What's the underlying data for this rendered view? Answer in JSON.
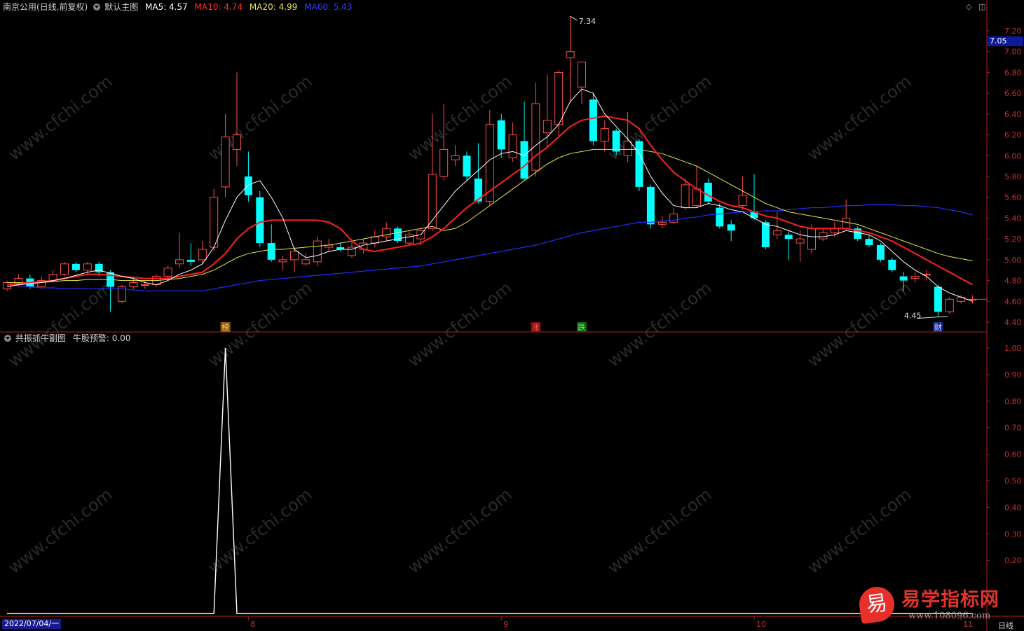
{
  "main_header": {
    "title": "南京公用(日线,前复权)",
    "template": "默认主图",
    "ma5": "MA5: 4.57",
    "ma10": "MA10: 4.74",
    "ma20": "MA20: 4.99",
    "ma60": "MA60: 5.43"
  },
  "sub_header": {
    "title": "共振抓牛副图",
    "indicator": "牛股预警: 0.00"
  },
  "window_controls": [
    "◇",
    "◫"
  ],
  "current_price_label": "7.05",
  "high_label": "7.34",
  "low_label": "4.45",
  "markers": [
    "榜",
    "涨",
    "跌",
    "财"
  ],
  "x_axis": {
    "start_date": "2022/07/04/一",
    "months": [
      "8",
      "9",
      "10",
      "11"
    ],
    "cycle": "日线"
  },
  "brand": {
    "icon": "易",
    "name": "易学指标网",
    "url": "www.108096.com"
  },
  "watermark": "www.cfchi.com",
  "colors": {
    "up": "#ff4d4d",
    "down": "#00ffff",
    "ma5": "#ffffff",
    "ma10": "#ff2020",
    "ma20": "#e6e64a",
    "ma60": "#2030ff",
    "axis": "#b02020"
  },
  "chart_data": [
    {
      "type": "candlestick",
      "title": "南京公用(日线,前复权)",
      "ylim": [
        4.4,
        7.25
      ],
      "yticks": [
        "7.20",
        "7.00",
        "6.80",
        "6.60",
        "6.40",
        "6.20",
        "6.00",
        "5.80",
        "5.60",
        "5.40",
        "5.20",
        "5.00",
        "4.80",
        "4.60",
        "4.40"
      ],
      "candles": [
        [
          4.72,
          4.78,
          4.8,
          4.7
        ],
        [
          4.76,
          4.82,
          4.86,
          4.74
        ],
        [
          4.82,
          4.74,
          4.86,
          4.72
        ],
        [
          4.74,
          4.8,
          4.84,
          4.72
        ],
        [
          4.8,
          4.86,
          4.9,
          4.78
        ],
        [
          4.86,
          4.96,
          4.98,
          4.84
        ],
        [
          4.96,
          4.9,
          4.98,
          4.88
        ],
        [
          4.9,
          4.96,
          4.98,
          4.86
        ],
        [
          4.96,
          4.88,
          4.98,
          4.84
        ],
        [
          4.88,
          4.74,
          4.9,
          4.5
        ],
        [
          4.6,
          4.74,
          4.76,
          4.58
        ],
        [
          4.74,
          4.78,
          4.82,
          4.72
        ],
        [
          4.76,
          4.76,
          4.8,
          4.72
        ],
        [
          4.76,
          4.84,
          4.86,
          4.74
        ],
        [
          4.84,
          4.92,
          4.94,
          4.8
        ],
        [
          4.96,
          5.0,
          5.26,
          4.92
        ],
        [
          5.0,
          4.98,
          5.16,
          4.94
        ],
        [
          5.0,
          5.1,
          5.18,
          4.96
        ],
        [
          5.12,
          5.6,
          5.68,
          5.08
        ],
        [
          5.7,
          6.18,
          6.4,
          5.6
        ],
        [
          6.06,
          6.2,
          6.8,
          5.9
        ],
        [
          5.8,
          5.62,
          6.04,
          5.56
        ],
        [
          5.6,
          5.16,
          5.66,
          5.12
        ],
        [
          5.16,
          5.0,
          5.34,
          4.98
        ],
        [
          4.98,
          5.0,
          5.04,
          4.9
        ],
        [
          5.0,
          5.08,
          5.12,
          4.88
        ],
        [
          4.96,
          5.0,
          5.06,
          4.94
        ],
        [
          4.98,
          5.18,
          5.22,
          4.94
        ],
        [
          5.12,
          5.14,
          5.2,
          5.08
        ],
        [
          5.12,
          5.1,
          5.16,
          5.08
        ],
        [
          5.04,
          5.12,
          5.2,
          5.02
        ],
        [
          5.1,
          5.16,
          5.2,
          5.06
        ],
        [
          5.16,
          5.22,
          5.28,
          5.12
        ],
        [
          5.22,
          5.3,
          5.36,
          5.18
        ],
        [
          5.3,
          5.18,
          5.32,
          5.16
        ],
        [
          5.16,
          5.24,
          5.28,
          5.14
        ],
        [
          5.2,
          5.28,
          5.3,
          5.14
        ],
        [
          5.3,
          5.82,
          6.4,
          5.28
        ],
        [
          5.8,
          6.06,
          6.5,
          5.76
        ],
        [
          5.96,
          6.0,
          6.1,
          5.9
        ],
        [
          6.0,
          5.8,
          6.04,
          5.76
        ],
        [
          5.78,
          5.56,
          6.12,
          5.54
        ],
        [
          5.56,
          6.3,
          6.44,
          5.52
        ],
        [
          6.34,
          6.06,
          6.4,
          5.98
        ],
        [
          5.98,
          6.2,
          6.32,
          5.94
        ],
        [
          6.14,
          5.78,
          6.52,
          5.76
        ],
        [
          5.86,
          6.5,
          6.7,
          5.8
        ],
        [
          6.22,
          6.34,
          6.78,
          6.08
        ],
        [
          6.3,
          6.8,
          6.82,
          6.18
        ],
        [
          6.94,
          7.0,
          7.34,
          6.52
        ],
        [
          6.66,
          6.9,
          6.9,
          6.5
        ],
        [
          6.54,
          6.14,
          6.6,
          6.1
        ],
        [
          6.14,
          6.26,
          6.34,
          6.04
        ],
        [
          6.24,
          6.04,
          6.26,
          6.0
        ],
        [
          6.0,
          6.14,
          6.42,
          5.94
        ],
        [
          6.14,
          5.7,
          6.16,
          5.66
        ],
        [
          5.7,
          5.34,
          5.72,
          5.3
        ],
        [
          5.34,
          5.36,
          5.42,
          5.3
        ],
        [
          5.36,
          5.44,
          5.5,
          5.34
        ],
        [
          5.5,
          5.72,
          5.78,
          5.48
        ],
        [
          5.52,
          5.68,
          5.9,
          5.5
        ],
        [
          5.74,
          5.56,
          5.78,
          5.54
        ],
        [
          5.5,
          5.32,
          5.54,
          5.3
        ],
        [
          5.34,
          5.28,
          5.38,
          5.18
        ],
        [
          5.52,
          5.62,
          5.8,
          5.48
        ],
        [
          5.46,
          5.4,
          5.82,
          5.38
        ],
        [
          5.36,
          5.12,
          5.38,
          5.1
        ],
        [
          5.24,
          5.28,
          5.46,
          5.2
        ],
        [
          5.24,
          5.2,
          5.28,
          5.0
        ],
        [
          5.16,
          5.2,
          5.28,
          4.98
        ],
        [
          5.1,
          5.3,
          5.34,
          5.06
        ],
        [
          5.2,
          5.26,
          5.3,
          5.18
        ],
        [
          5.26,
          5.3,
          5.36,
          5.22
        ],
        [
          5.3,
          5.4,
          5.58,
          5.28
        ],
        [
          5.3,
          5.2,
          5.32,
          5.18
        ],
        [
          5.2,
          5.14,
          5.24,
          5.12
        ],
        [
          5.14,
          5.0,
          5.16,
          4.98
        ],
        [
          5.0,
          4.9,
          5.02,
          4.88
        ],
        [
          4.84,
          4.8,
          4.88,
          4.7
        ],
        [
          4.82,
          4.84,
          4.88,
          4.78
        ],
        [
          4.86,
          4.86,
          4.9,
          4.8
        ],
        [
          4.74,
          4.5,
          4.76,
          4.45
        ],
        [
          4.5,
          4.62,
          4.64,
          4.48
        ],
        [
          4.6,
          4.64,
          4.66,
          4.58
        ],
        [
          4.62,
          4.62,
          4.66,
          4.58
        ]
      ],
      "ma5": [
        4.74,
        4.76,
        4.77,
        4.78,
        4.8,
        4.82,
        4.85,
        4.88,
        4.9,
        4.87,
        4.84,
        4.82,
        4.78,
        4.76,
        4.8,
        4.86,
        4.9,
        4.96,
        5.12,
        5.38,
        5.6,
        5.72,
        5.76,
        5.6,
        5.4,
        5.1,
        5.02,
        5.04,
        5.08,
        5.1,
        5.1,
        5.14,
        5.16,
        5.18,
        5.2,
        5.22,
        5.24,
        5.38,
        5.52,
        5.66,
        5.76,
        5.86,
        5.96,
        6.02,
        6.04,
        6.0,
        6.1,
        6.18,
        6.3,
        6.52,
        6.64,
        6.6,
        6.4,
        6.28,
        6.16,
        6.02,
        5.8,
        5.64,
        5.52,
        5.5,
        5.5,
        5.54,
        5.52,
        5.48,
        5.46,
        5.4,
        5.34,
        5.32,
        5.28,
        5.24,
        5.22,
        5.22,
        5.24,
        5.28,
        5.26,
        5.24,
        5.18,
        5.08,
        4.98,
        4.9,
        4.84,
        4.74,
        4.68,
        4.64,
        4.6
      ],
      "ma10": [
        4.76,
        4.77,
        4.78,
        4.79,
        4.8,
        4.82,
        4.84,
        4.86,
        4.86,
        4.85,
        4.84,
        4.83,
        4.82,
        4.82,
        4.82,
        4.84,
        4.86,
        4.88,
        4.96,
        5.06,
        5.2,
        5.3,
        5.36,
        5.38,
        5.38,
        5.38,
        5.38,
        5.38,
        5.36,
        5.3,
        5.18,
        5.1,
        5.08,
        5.1,
        5.12,
        5.14,
        5.16,
        5.22,
        5.3,
        5.4,
        5.5,
        5.58,
        5.66,
        5.74,
        5.82,
        5.9,
        6.0,
        6.08,
        6.18,
        6.28,
        6.34,
        6.36,
        6.38,
        6.36,
        6.34,
        6.26,
        6.1,
        5.96,
        5.84,
        5.76,
        5.68,
        5.62,
        5.56,
        5.52,
        5.5,
        5.46,
        5.42,
        5.4,
        5.36,
        5.32,
        5.3,
        5.3,
        5.3,
        5.3,
        5.28,
        5.26,
        5.22,
        5.18,
        5.12,
        5.06,
        5.0,
        4.94,
        4.88,
        4.82,
        4.76
      ],
      "ma20": [
        4.78,
        4.78,
        4.78,
        4.78,
        4.79,
        4.8,
        4.8,
        4.81,
        4.81,
        4.81,
        4.8,
        4.8,
        4.8,
        4.8,
        4.81,
        4.82,
        4.84,
        4.86,
        4.9,
        4.96,
        5.02,
        5.06,
        5.08,
        5.1,
        5.1,
        5.11,
        5.12,
        5.13,
        5.14,
        5.16,
        5.18,
        5.2,
        5.22,
        5.24,
        5.26,
        5.28,
        5.3,
        5.32,
        5.28,
        5.3,
        5.36,
        5.44,
        5.52,
        5.6,
        5.68,
        5.76,
        5.84,
        5.92,
        5.98,
        6.02,
        6.04,
        6.06,
        6.06,
        6.06,
        6.06,
        6.06,
        6.04,
        6.02,
        5.98,
        5.94,
        5.9,
        5.84,
        5.78,
        5.72,
        5.66,
        5.6,
        5.54,
        5.5,
        5.46,
        5.44,
        5.42,
        5.4,
        5.38,
        5.36,
        5.34,
        5.3,
        5.26,
        5.22,
        5.18,
        5.14,
        5.1,
        5.06,
        5.03,
        5.01,
        4.99
      ],
      "ma60": [
        4.76,
        4.75,
        4.74,
        4.73,
        4.73,
        4.72,
        4.72,
        4.72,
        4.72,
        4.72,
        4.72,
        4.71,
        4.7,
        4.7,
        4.7,
        4.7,
        4.7,
        4.7,
        4.72,
        4.74,
        4.76,
        4.78,
        4.8,
        4.81,
        4.82,
        4.83,
        4.84,
        4.85,
        4.86,
        4.87,
        4.88,
        4.89,
        4.9,
        4.91,
        4.92,
        4.93,
        4.94,
        4.96,
        4.98,
        5.0,
        5.02,
        5.04,
        5.06,
        5.08,
        5.1,
        5.12,
        5.14,
        5.17,
        5.2,
        5.23,
        5.26,
        5.28,
        5.3,
        5.32,
        5.34,
        5.36,
        5.36,
        5.37,
        5.38,
        5.4,
        5.41,
        5.43,
        5.44,
        5.45,
        5.46,
        5.46,
        5.47,
        5.47,
        5.48,
        5.49,
        5.5,
        5.5,
        5.51,
        5.52,
        5.52,
        5.53,
        5.53,
        5.53,
        5.52,
        5.52,
        5.51,
        5.5,
        5.48,
        5.46,
        5.43
      ]
    },
    {
      "type": "line",
      "title": "共振抓牛副图",
      "series": [
        {
          "name": "牛股预警",
          "values": [
            0,
            0,
            0,
            0,
            0,
            0,
            0,
            0,
            0,
            0,
            0,
            0,
            0,
            0,
            0,
            0,
            0,
            0,
            0,
            1,
            0,
            0,
            0,
            0,
            0,
            0,
            0,
            0,
            0,
            0,
            0,
            0,
            0,
            0,
            0,
            0,
            0,
            0,
            0,
            0,
            0,
            0,
            0,
            0,
            0,
            0,
            0,
            0,
            0,
            0,
            0,
            0,
            0,
            0,
            0,
            0,
            0,
            0,
            0,
            0,
            0,
            0,
            0,
            0,
            0,
            0,
            0,
            0,
            0,
            0,
            0,
            0,
            0,
            0,
            0,
            0,
            0,
            0,
            0,
            0,
            0,
            0,
            0,
            0,
            0
          ]
        }
      ],
      "ylim": [
        0,
        1
      ],
      "yticks": [
        "1.00",
        "0.90",
        "0.80",
        "0.70",
        "0.60",
        "0.50",
        "0.40",
        "0.30",
        "0.20"
      ]
    }
  ]
}
